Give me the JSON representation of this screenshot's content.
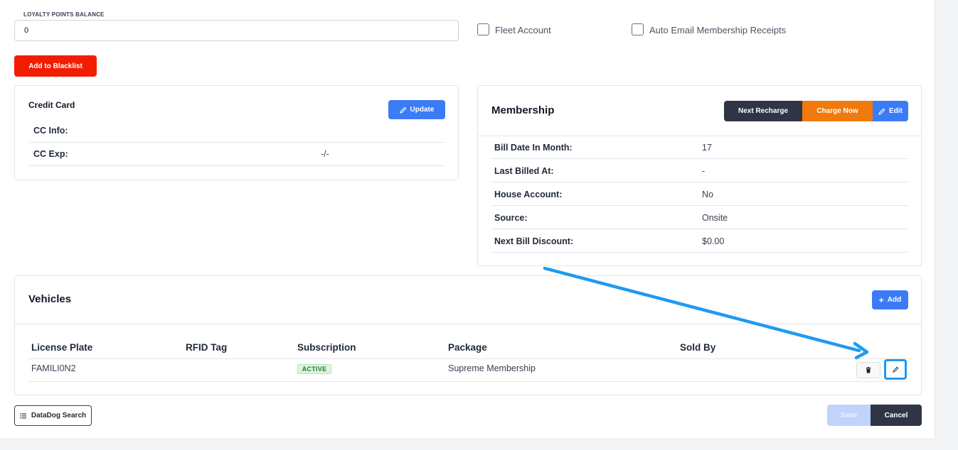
{
  "loyalty": {
    "label": "LOYALTY POINTS BALANCE",
    "value": "0"
  },
  "checkboxes": {
    "fleet": "Fleet Account",
    "auto_email": "Auto Email Membership Receipts"
  },
  "blacklist_label": "Add to Blacklist",
  "credit_card": {
    "title": "Credit Card",
    "update_label": "Update",
    "rows": [
      {
        "label": "CC Info:",
        "value": ""
      },
      {
        "label": "CC Exp:",
        "value": "-/-"
      }
    ]
  },
  "membership": {
    "title": "Membership",
    "next_recharge_label": "Next Recharge",
    "charge_now_label": "Charge Now",
    "edit_label": "Edit",
    "rows": [
      {
        "label": "Bill Date In Month:",
        "value": "17"
      },
      {
        "label": "Last Billed At:",
        "value": "-"
      },
      {
        "label": "House Account:",
        "value": "No"
      },
      {
        "label": "Source:",
        "value": "Onsite"
      },
      {
        "label": "Next Bill Discount:",
        "value": "$0.00"
      }
    ]
  },
  "vehicles": {
    "title": "Vehicles",
    "add_label": "Add",
    "columns": [
      "License Plate",
      "RFID Tag",
      "Subscription",
      "Package",
      "Sold By"
    ],
    "rows": [
      {
        "license_plate": "FAMILI0N2",
        "rfid_tag": "",
        "subscription": "ACTIVE",
        "package": "Supreme Membership",
        "sold_by": ""
      }
    ]
  },
  "footer": {
    "datadog_label": "DataDog Search",
    "save_label": "Save",
    "cancel_label": "Cancel"
  },
  "colors": {
    "primary": "#3b7cf6",
    "danger": "#f21d00",
    "dark": "#2f3546",
    "orange": "#f07a0c",
    "annotation": "#1e9bf0",
    "success_bg": "#dcf5dd"
  },
  "icons": [
    "pencil-icon",
    "plus-icon",
    "trash-icon",
    "list-icon"
  ]
}
